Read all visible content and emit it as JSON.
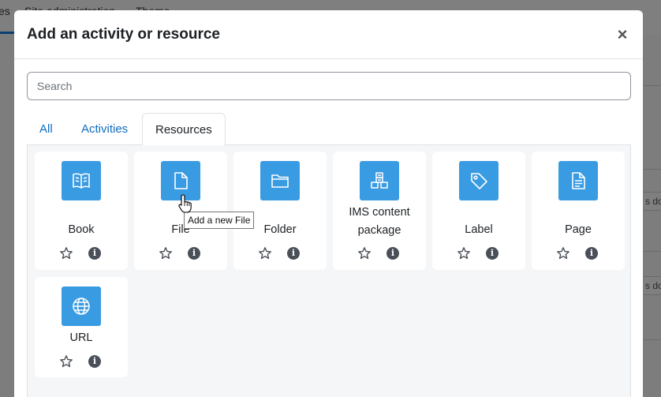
{
  "background": {
    "nav_items": [
      "es",
      "Site administration",
      "Theme"
    ],
    "right_fragments": [
      "s do",
      "s do"
    ]
  },
  "modal": {
    "title": "Add an activity or resource",
    "close_label": "×"
  },
  "search": {
    "placeholder": "Search",
    "value": ""
  },
  "tabs": [
    {
      "label": "All",
      "active": false
    },
    {
      "label": "Activities",
      "active": false
    },
    {
      "label": "Resources",
      "active": true
    }
  ],
  "cards": [
    {
      "name": "Book",
      "icon": "book-icon"
    },
    {
      "name": "File",
      "icon": "file-icon"
    },
    {
      "name": "Folder",
      "icon": "folder-icon"
    },
    {
      "name": "IMS content package",
      "icon": "package-icon"
    },
    {
      "name": "Label",
      "icon": "tag-icon"
    },
    {
      "name": "Page",
      "icon": "page-icon"
    },
    {
      "name": "URL",
      "icon": "globe-icon"
    }
  ],
  "tooltip": "Add a new File",
  "colors": {
    "accent": "#399be2",
    "link": "#0f6cbf",
    "panel": "#f5f6f8"
  }
}
